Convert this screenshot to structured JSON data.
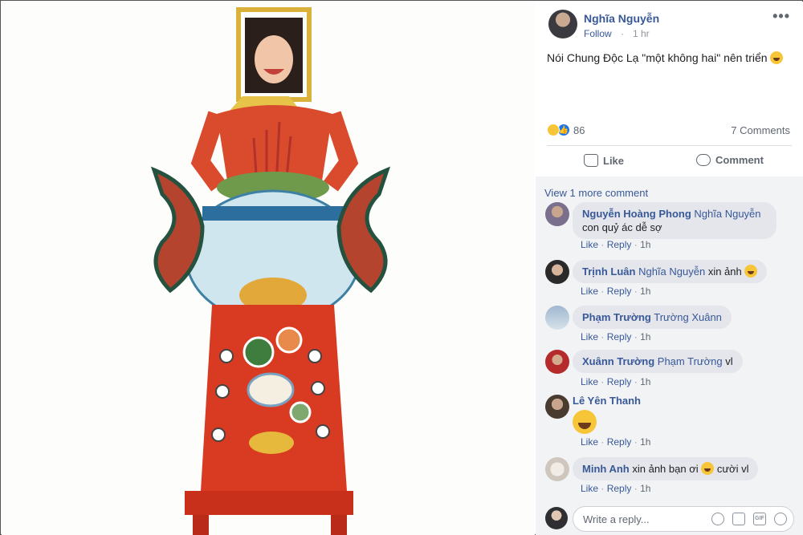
{
  "post": {
    "author": "Nghĩa Nguyễn",
    "follow": "Follow",
    "time_sep": "·",
    "time_ago": "1 hr",
    "more_icon": "more-options-icon",
    "text": "Nói Chung Độc Lạ \"một không hai\" nên triển",
    "reaction_count": "86",
    "comments_count": "7 Comments",
    "like_label": "Like",
    "comment_label": "Comment"
  },
  "comments": {
    "view_more": "View 1 more comment",
    "items": [
      {
        "name": "Nguyễn Hoàng Phong",
        "tag": "Nghĩa Nguyễn",
        "text": "con quỷ ác dễ sợ",
        "time": "1h"
      },
      {
        "name": "Trịnh Luân",
        "tag": "Nghĩa Nguyễn",
        "text": "xin ảnh",
        "time": "1h"
      },
      {
        "name": "Phạm Trường",
        "tag": "Trường Xuânn",
        "text": "",
        "time": "1h"
      },
      {
        "name": "Xuânn Trường",
        "tag": "Phạm Trường",
        "text": "vl",
        "time": "1h"
      },
      {
        "name": "Lê Yên Thanh",
        "tag": "",
        "text": "",
        "time": "1h"
      },
      {
        "name": "Minh Anh",
        "tag": "",
        "text": "xin ảnh bạn ơi",
        "text2": "cười vl",
        "time": "1h"
      }
    ],
    "like": "Like",
    "reply": "Reply",
    "sep": "·"
  },
  "reply_box": {
    "placeholder": "Write a reply..."
  },
  "colors": {
    "link": "#385898",
    "bubble": "#e4e6eb",
    "panel_bg": "#f2f3f5",
    "dress_red": "#d83a22"
  }
}
